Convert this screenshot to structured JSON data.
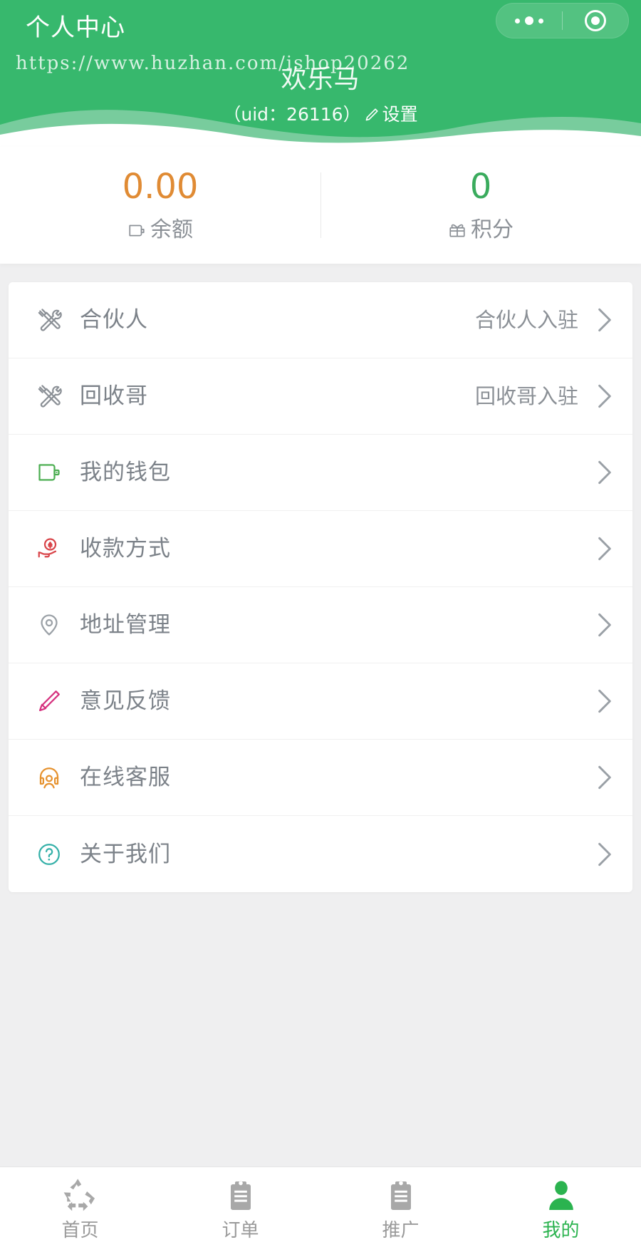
{
  "theme": {
    "brand_green": "#37b86d",
    "wave_green": "#8fd3ae",
    "amount_orange": "#e08b34",
    "points_green": "#3aab5d",
    "active_tab_green": "#2bb34f",
    "label_gray": "#7c8289",
    "page_bg": "#efeff0"
  },
  "header": {
    "nav_title": "个人中心",
    "watermark": "https://www.huzhan.com/ishop20262",
    "nickname": "欢乐马",
    "uid_text": "（uid：26116）",
    "settings_label": "设置",
    "capsule": {
      "more_icon": "more-dots-icon",
      "target_icon": "target-circle-icon"
    }
  },
  "stats": [
    {
      "value": "0.00",
      "label": "余额",
      "icon": "wallet-icon",
      "color_key": "amount"
    },
    {
      "value": "0",
      "label": "积分",
      "icon": "points-icon",
      "color_key": "points"
    }
  ],
  "menu": [
    {
      "label": "合伙人",
      "extra": "合伙人入驻",
      "icon": "wrench-screwdriver-icon",
      "icon_color": "#8b9096"
    },
    {
      "label": "回收哥",
      "extra": "回收哥入驻",
      "icon": "wrench-screwdriver-icon",
      "icon_color": "#8b9096"
    },
    {
      "label": "我的钱包",
      "extra": "",
      "icon": "wallet-icon",
      "icon_color": "#4cae52"
    },
    {
      "label": "收款方式",
      "extra": "",
      "icon": "hand-yuan-icon",
      "icon_color": "#d9454a"
    },
    {
      "label": "地址管理",
      "extra": "",
      "icon": "location-pin-icon",
      "icon_color": "#9aa0a6"
    },
    {
      "label": "意见反馈",
      "extra": "",
      "icon": "pencil-icon",
      "icon_color": "#d6337f"
    },
    {
      "label": "在线客服",
      "extra": "",
      "icon": "headset-person-icon",
      "icon_color": "#e6922f"
    },
    {
      "label": "关于我们",
      "extra": "",
      "icon": "question-circle-icon",
      "icon_color": "#34b0a8"
    }
  ],
  "tabbar": [
    {
      "label": "首页",
      "icon": "recycle-icon",
      "active": false
    },
    {
      "label": "订单",
      "icon": "clipboard-icon",
      "active": false
    },
    {
      "label": "推广",
      "icon": "clipboard-icon",
      "active": false
    },
    {
      "label": "我的",
      "icon": "person-icon",
      "active": true
    }
  ]
}
